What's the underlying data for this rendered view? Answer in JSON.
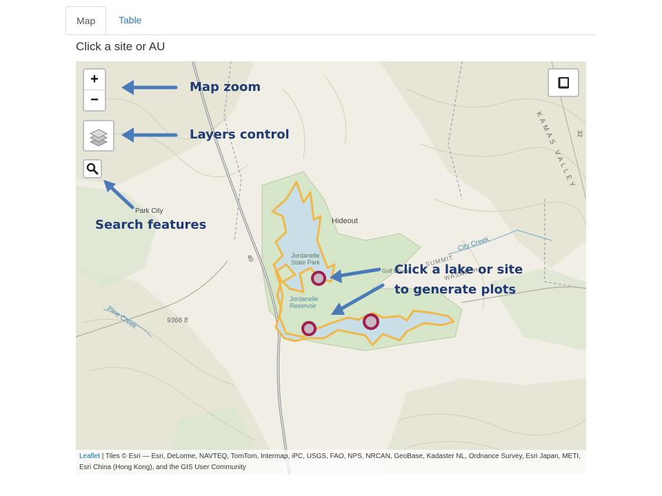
{
  "tabs": [
    {
      "label": "Map",
      "active": true
    },
    {
      "label": "Table",
      "active": false
    }
  ],
  "prompt": "Click a site or AU",
  "map": {
    "controls": {
      "zoom_in": "+",
      "zoom_out": "−",
      "layers_icon": "layers-icon",
      "search_icon": "search-icon",
      "fullscreen_icon": "fullscreen-icon"
    },
    "annotations": {
      "zoom": "Map zoom",
      "layers": "Layers control",
      "search": "Search features",
      "click_line1": "Click a lake or site",
      "click_line2": "to generate plots"
    },
    "labels": {
      "park_city": "Park City",
      "hideout": "Hideout",
      "jordanelle_sp_1": "Jordanelle",
      "jordanelle_sp_2": "State Park",
      "jordanelle_res_1": "Jordanelle",
      "jordanelle_res_2": "Reservoir",
      "pine_creek": "Pine Creek",
      "city_creek": "City Creek",
      "elevation": "9366 ft",
      "kamas_valley": "KAMAS VALLEY",
      "summit": "SUMMIT",
      "wasatch": "WASATCH",
      "golf": "Golf Course",
      "hwy40": "40",
      "hwy32": "32"
    },
    "colors": {
      "accent_arrow": "#4a7ab8",
      "annotation_text": "#1f3b73",
      "lake_fill": "#c9dfe8",
      "lake_outline": "#f0b84a",
      "site_marker": "#9c1f4f"
    },
    "attribution": {
      "link": "Leaflet",
      "text": " | Tiles © Esri — Esri, DeLorme, NAVTEQ, TomTom, Intermap, iPC, USGS, FAO, NPS, NRCAN, GeoBase, Kadaster NL, Ordnance Survey, Esri Japan, METI, Esri China (Hong Kong), and the GIS User Community"
    }
  }
}
